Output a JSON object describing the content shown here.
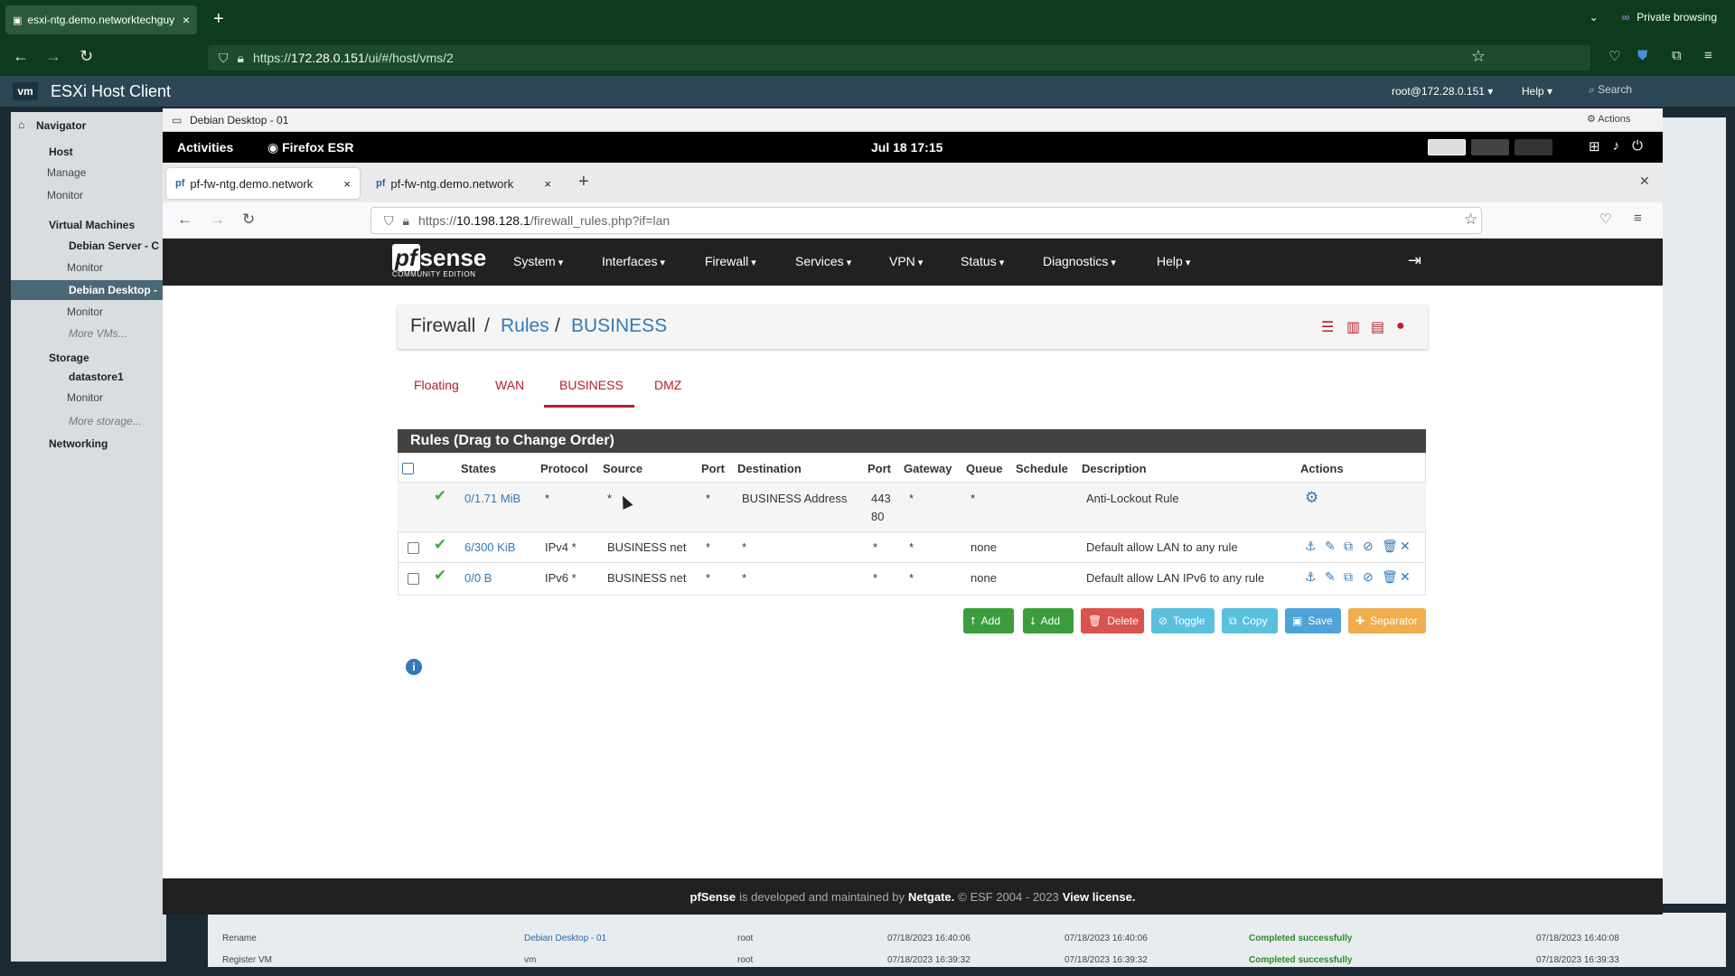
{
  "outer_browser": {
    "tab_title": "esxi-ntg.demo.networktechguy",
    "private_label": "Private browsing",
    "url_prefix": "https://",
    "url_host": "172.28.0.151",
    "url_path": "/ui/#/host/vms/2"
  },
  "esxi": {
    "logo": "vm",
    "title": "ESXi Host Client",
    "user": "root@172.28.0.151 ▾",
    "help": "Help ▾",
    "search": "Search"
  },
  "navigator": {
    "title": "Navigator",
    "items": [
      "Host",
      "Manage",
      "Monitor",
      "Virtual Machines",
      "Debian Server - C",
      "Monitor",
      "Debian Desktop -",
      "Monitor",
      "More VMs...",
      "Storage",
      "datastore1",
      "Monitor",
      "More storage...",
      "Networking"
    ]
  },
  "tasks": [
    {
      "task": "Rename",
      "target": "Debian Desktop - 01",
      "initiator": "root",
      "queued": "07/18/2023 16:40:06",
      "started": "07/18/2023 16:40:06",
      "result": "Completed successfully",
      "completed": "07/18/2023 16:40:08"
    },
    {
      "task": "Register VM",
      "target": "vm",
      "initiator": "root",
      "queued": "07/18/2023 16:39:32",
      "started": "07/18/2023 16:39:32",
      "result": "Completed successfully",
      "completed": "07/18/2023 16:39:33"
    }
  ],
  "console": {
    "title": "Debian Desktop - 01",
    "actions": "⚙ Actions",
    "gnome_activities": "Activities",
    "gnome_app": "Firefox ESR",
    "gnome_clock": "Jul 18  17:15"
  },
  "inner_browser": {
    "tab1": "pf-fw-ntg.demo.network",
    "tab2": "pf-fw-ntg.demo.network",
    "url_prefix": "https://",
    "url_host": "10.198.128.1",
    "url_path": "/firewall_rules.php?if=lan"
  },
  "pfsense": {
    "logo_pf": "pf",
    "logo_sense": "sense",
    "logo_edition": "COMMUNITY EDITION",
    "menu": [
      "System",
      "Interfaces",
      "Firewall",
      "Services",
      "VPN",
      "Status",
      "Diagnostics",
      "Help"
    ],
    "breadcrumb": {
      "root": "Firewall",
      "rules": "Rules",
      "iface": "BUSINESS"
    },
    "tabs": [
      "Floating",
      "WAN",
      "BUSINESS",
      "DMZ"
    ],
    "panel_title": "Rules (Drag to Change Order)",
    "columns": [
      "States",
      "Protocol",
      "Source",
      "Port",
      "Destination",
      "Port",
      "Gateway",
      "Queue",
      "Schedule",
      "Description",
      "Actions"
    ],
    "rows": [
      {
        "states": "0/1.71 MiB",
        "protocol": "*",
        "source": "*",
        "sport": "*",
        "destination": "BUSINESS Address",
        "dport1": "443",
        "dport2": "80",
        "gateway": "*",
        "queue": "*",
        "schedule": "",
        "description": "Anti-Lockout Rule"
      },
      {
        "states": "6/300 KiB",
        "protocol": "IPv4 *",
        "source": "BUSINESS net",
        "sport": "*",
        "destination": "*",
        "dport1": "*",
        "dport2": "",
        "gateway": "*",
        "queue": "none",
        "schedule": "",
        "description": "Default allow LAN to any rule"
      },
      {
        "states": "0/0 B",
        "protocol": "IPv6 *",
        "source": "BUSINESS net",
        "sport": "*",
        "destination": "*",
        "dport1": "*",
        "dport2": "",
        "gateway": "*",
        "queue": "none",
        "schedule": "",
        "description": "Default allow LAN IPv6 to any rule"
      }
    ],
    "buttons": {
      "add_top": "Add",
      "add_bottom": "Add",
      "delete": "Delete",
      "toggle": "Toggle",
      "copy": "Copy",
      "save": "Save",
      "separator": "Separator"
    },
    "footer": {
      "brand": "pfSense",
      "text1": "is developed and maintained by",
      "company": "Netgate.",
      "text2": "© ESF 2004 - 2023",
      "license": "View license."
    }
  }
}
